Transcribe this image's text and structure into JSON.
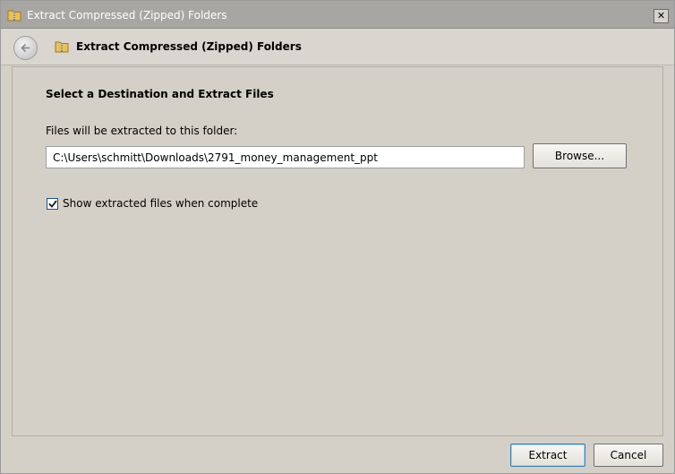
{
  "window": {
    "title": "Extract Compressed (Zipped) Folders",
    "close_glyph": "✕",
    "close_icon": "close-icon",
    "title_icon": "zip-folder-icon"
  },
  "header": {
    "title": "Extract Compressed (Zipped) Folders",
    "back_icon": "back-arrow-icon",
    "folder_icon": "zip-folder-icon"
  },
  "main": {
    "heading": "Select a Destination and Extract Files",
    "destination_label": "Files will be extracted to this folder:",
    "destination_value": "C:\\Users\\schmitt\\Downloads\\2791_money_management_ppt",
    "browse_label": "Browse...",
    "show_files_label": "Show extracted files when complete",
    "show_files_checked": true
  },
  "footer": {
    "extract_label": "Extract",
    "cancel_label": "Cancel"
  },
  "colors": {
    "titlebar": "#a8a6a2",
    "dialog_bg": "#d4d0c8",
    "default_button_border": "#3c7fb1"
  }
}
